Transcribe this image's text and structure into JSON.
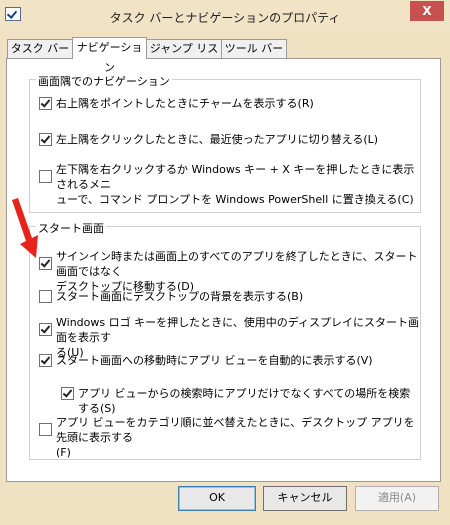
{
  "window": {
    "title": "タスク バーとナビゲーションのプロパティ",
    "close": "X"
  },
  "tabs": [
    {
      "label": "タスク バー"
    },
    {
      "label": "ナビゲーション"
    },
    {
      "label": "ジャンプ リスト"
    },
    {
      "label": "ツール バー"
    }
  ],
  "corner_group": {
    "label": "画面隅でのナビゲーション",
    "items": [
      {
        "text": "右上隅をポイントしたときにチャームを表示する(R)",
        "checked": true
      },
      {
        "text": "左上隅をクリックしたときに、最近使ったアプリに切り替える(L)",
        "checked": true
      },
      {
        "text": "左下隅を右クリックするか Windows キー + X キーを押したときに表示されるメニ\nューで、コマンド プロンプトを Windows PowerShell に置き換える(C)",
        "checked": false
      }
    ]
  },
  "start_group": {
    "label": "スタート画面",
    "items": [
      {
        "text": "サインイン時または画面上のすべてのアプリを終了したときに、スタート画面ではなく\nデスクトップに移動する(D)",
        "checked": true
      },
      {
        "text": "スタート画面にデスクトップの背景を表示する(B)",
        "checked": false
      },
      {
        "text": "Windows ロゴ キーを押したときに、使用中のディスプレイにスタート画面を表示す\nる(U)",
        "checked": true
      },
      {
        "text": "スタート画面への移動時にアプリ ビューを自動的に表示する(V)",
        "checked": true
      },
      {
        "text": "アプリ ビューからの検索時にアプリだけでなくすべての場所を検索する(S)",
        "checked": true
      },
      {
        "text": "アプリ ビューをカテゴリ順に並べ替えたときに、デスクトップ アプリを先頭に表示する\n(F)",
        "checked": false
      }
    ]
  },
  "buttons": {
    "ok": "OK",
    "cancel": "キャンセル",
    "apply": "適用(A)"
  },
  "colors": {
    "arrow": "#e8231c",
    "close": "#c75050",
    "window": "#efe1c2"
  }
}
